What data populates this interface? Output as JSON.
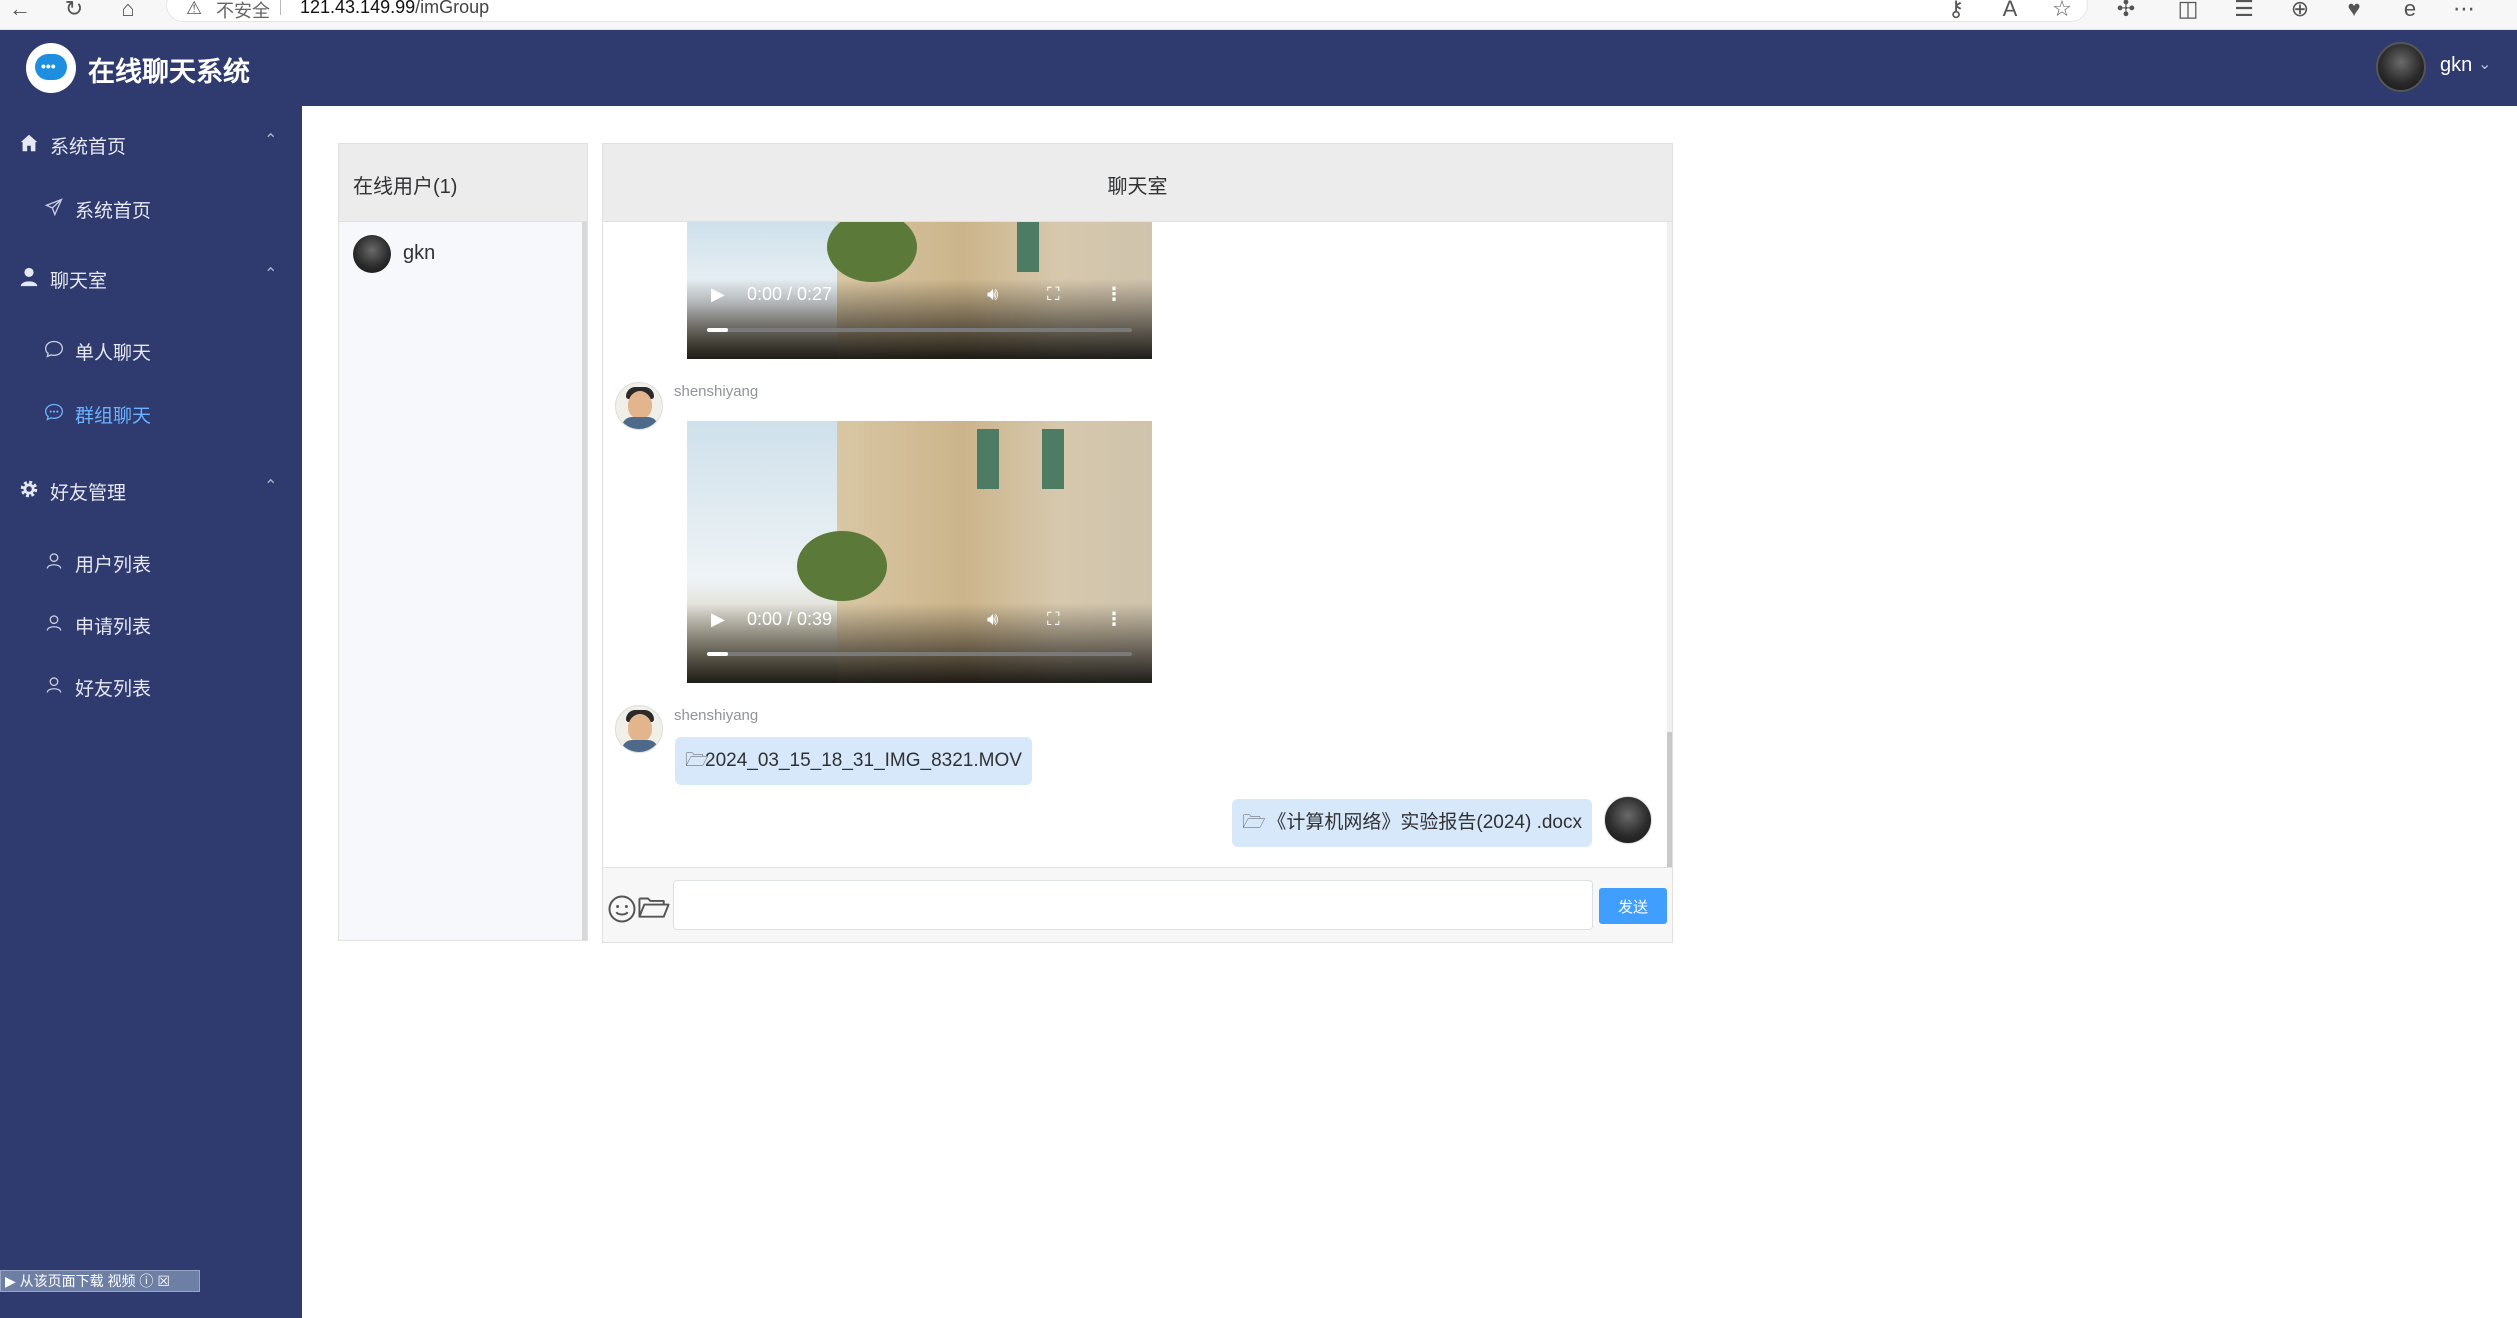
{
  "browser": {
    "insecure_label": "不安全",
    "url_host": "121.43.149.99",
    "url_path": "/imGroup"
  },
  "header": {
    "app_title": "在线聊天系统",
    "username": "gkn"
  },
  "sidebar": {
    "groups": [
      {
        "label": "系统首页",
        "icon": "home-icon",
        "items": [
          {
            "label": "系统首页",
            "icon": "send-icon"
          }
        ]
      },
      {
        "label": "聊天室",
        "icon": "user-icon",
        "items": [
          {
            "label": "单人聊天",
            "icon": "chat-bubble-icon"
          },
          {
            "label": "群组聊天",
            "icon": "chat-dots-icon",
            "active": true
          }
        ]
      },
      {
        "label": "好友管理",
        "icon": "gear-icon",
        "items": [
          {
            "label": "用户列表",
            "icon": "person-icon"
          },
          {
            "label": "申请列表",
            "icon": "person-icon"
          },
          {
            "label": "好友列表",
            "icon": "person-icon"
          }
        ]
      }
    ],
    "helper_label": "从该页面下载 视频"
  },
  "online_users": {
    "title": "在线用户(1)",
    "users": [
      {
        "name": "gkn"
      }
    ]
  },
  "chat": {
    "title": "聊天室",
    "messages": [
      {
        "type": "video",
        "time": "0:00 / 0:27",
        "progress": 0.05
      },
      {
        "type": "video",
        "sender": "shenshiyang",
        "time": "0:00 / 0:39",
        "progress": 0.05
      },
      {
        "type": "file",
        "sender": "shenshiyang",
        "file_name": "2024_03_15_18_31_IMG_8321.MOV"
      },
      {
        "type": "file",
        "sender": "gkn",
        "self": true,
        "file_name": "《计算机网络》实验报告(2024) .docx"
      }
    ],
    "input_value": "",
    "send_label": "发送"
  },
  "colors": {
    "sidebar_bg": "#2f3a6e",
    "active_item": "#6cb2ff",
    "send_button": "#409eff",
    "file_bubble": "#d7e8fb"
  }
}
